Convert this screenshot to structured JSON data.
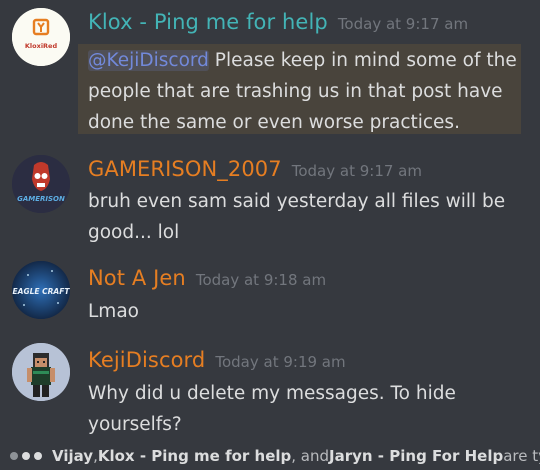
{
  "colors": {
    "background": "#36393f",
    "highlight": "#49443c",
    "mention": "#7289da",
    "name_teal": "#43b4b6",
    "name_orange": "#e67e22",
    "timestamp": "#72767d",
    "text": "#dcddde"
  },
  "messages": [
    {
      "author": "Klox - Ping me for help",
      "timestamp": "Today at 9:17 am",
      "avatar_text": "KloxiRed",
      "mention": "@KejiDiscord",
      "text": " Please keep in mind some of the people that are trashing us in that post have done the same or even worse practices."
    },
    {
      "author": "GAMERISON_2007",
      "timestamp": "Today at 9:17 am",
      "avatar_text": "GAMERISON",
      "text": "bruh even sam said yesterday all files will be good... lol"
    },
    {
      "author": "Not A Jen",
      "timestamp": "Today at 9:18 am",
      "avatar_text": "EAGLE CRAFT",
      "text": "Lmao"
    },
    {
      "author": "KejiDiscord",
      "timestamp": "Today at 9:19 am",
      "text": "Why did u delete my messages. To hide yourselfs?"
    }
  ],
  "typing": {
    "user1": "Vijay",
    "sep1": ", ",
    "user2": "Klox - Ping me for help",
    "sep2": ", and ",
    "user3": "Jaryn - Ping For Help",
    "suffix": " are ty"
  }
}
